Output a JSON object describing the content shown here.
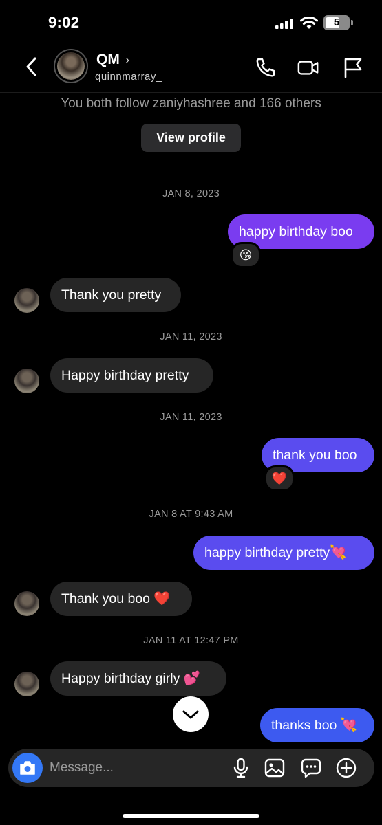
{
  "status_bar": {
    "time": "9:02",
    "battery": "5"
  },
  "header": {
    "name": "QM",
    "chevron": "›",
    "username": "quinnmarray_"
  },
  "profile_card": {
    "follow_text": "You both follow zaniyhashree and 166 others",
    "view_profile_label": "View profile"
  },
  "thread": {
    "date_1": "JAN 8, 2023",
    "msg_1": "happy birthday boo",
    "reaction_1": "😘",
    "msg_2": "Thank you pretty",
    "date_2": "JAN 11, 2023",
    "msg_3": "Happy birthday pretty",
    "date_3": "JAN 11, 2023",
    "msg_4": "thank you boo",
    "reaction_2": "❤️",
    "date_4": "JAN 8 AT 9:43 AM",
    "msg_5": "happy birthday pretty💘",
    "msg_6": "Thank you boo ❤️",
    "date_5": "JAN 11 AT 12:47 PM",
    "msg_7": "Happy birthday girly 💕",
    "msg_8": "thanks boo 💘"
  },
  "composer": {
    "placeholder": "Message..."
  },
  "icons": {
    "back": "chevron-left-icon",
    "call": "phone-icon",
    "video": "video-camera-icon",
    "report": "flag-icon",
    "camera": "camera-icon",
    "mic": "microphone-icon",
    "gallery": "image-icon",
    "sticker": "sticker-chat-icon",
    "more": "plus-circle-icon",
    "scroll": "chevron-down-icon"
  },
  "colors": {
    "background": "#000000",
    "received_bubble": "#262626",
    "sent_purple": "#7a3cf0",
    "sent_indigo": "#5a4cef",
    "sent_blue": "#3d5af0",
    "camera_button": "#3478f6"
  }
}
